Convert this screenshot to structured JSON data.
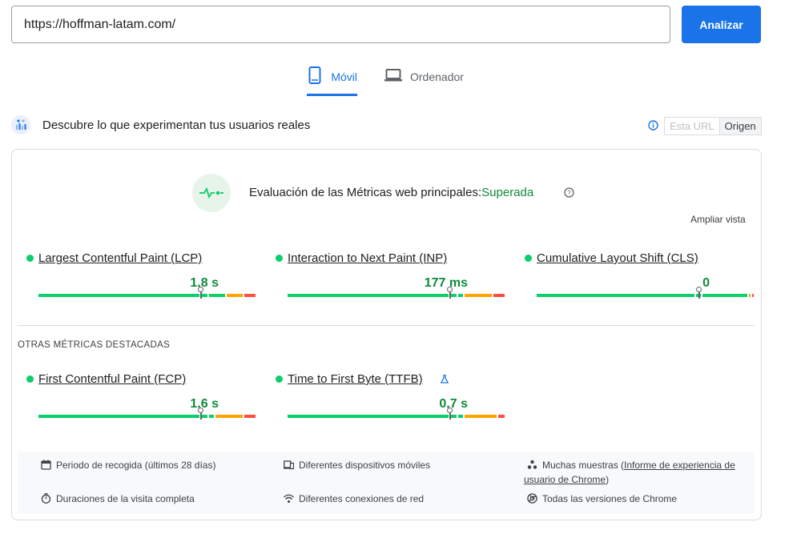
{
  "search": {
    "url_value": "https://hoffman-latam.com/",
    "analyze_label": "Analizar"
  },
  "tabs": [
    {
      "label": "Móvil",
      "active": true,
      "icon": "smartphone-icon"
    },
    {
      "label": "Ordenador",
      "active": false,
      "icon": "laptop-icon"
    }
  ],
  "section": {
    "title": "Descubre lo que experimentan tus usuarios reales",
    "toggle": {
      "url_label": "Esta URL",
      "origin_label": "Origen",
      "selected": "Origen"
    }
  },
  "assessment": {
    "label": "Evaluación de las Métricas web principales:",
    "status": "Superada",
    "expand_label": "Ampliar vista"
  },
  "core_metrics": [
    {
      "name": "Largest Contentful Paint (LCP)",
      "value": "1,8 s",
      "status": "good",
      "marker_fraction": 0.75
    },
    {
      "name": "Interaction to Next Paint (INP)",
      "value": "177 ms",
      "status": "good",
      "marker_fraction": 0.75
    },
    {
      "name": "Cumulative Layout Shift (CLS)",
      "value": "0",
      "status": "good",
      "marker_fraction": 0.75
    }
  ],
  "other_label": "OTRAS MÉTRICAS DESTACADAS",
  "other_metrics": [
    {
      "name": "First Contentful Paint (FCP)",
      "value": "1,6 s",
      "status": "good",
      "marker_fraction": 0.75
    },
    {
      "name": "Time to First Byte (TTFB)",
      "value": "0,7 s",
      "status": "good",
      "marker_fraction": 0.75,
      "experimental": true
    }
  ],
  "info": {
    "period": "Periodo de recogida (últimos 28 días)",
    "devices": "Diferentes dispositivos móviles",
    "samples_prefix": "Muchas muestras (",
    "samples_link": "Informe de experiencia de usuario de Chrome",
    "samples_suffix": ")",
    "durations": "Duraciones de la visita completa",
    "connections": "Diferentes conexiones de red",
    "versions": "Todas las versiones de Chrome"
  },
  "colors": {
    "accent": "#1a73e8",
    "good": "#0cce6b",
    "needs_improvement": "#ffa400",
    "poor": "#ff4e42",
    "pass_text": "#0d8a3a"
  }
}
